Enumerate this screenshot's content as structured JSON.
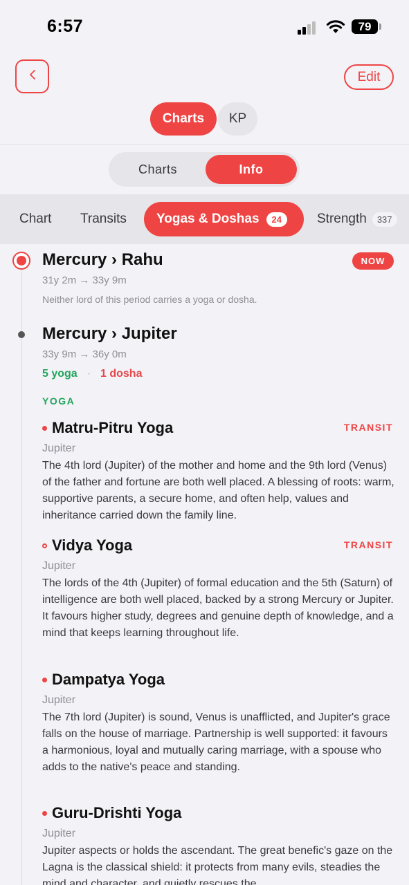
{
  "status": {
    "time": "6:57",
    "battery": "79"
  },
  "header": {
    "back_icon": "chevron-left-icon",
    "edit_label": "Edit"
  },
  "top_segment": {
    "charts": "Charts",
    "kp": "KP"
  },
  "mid_segment": {
    "charts": "Charts",
    "info": "Info"
  },
  "tabs": {
    "chart": "Chart",
    "transits": "Transits",
    "yogas": "Yogas & Doshas",
    "yogas_badge": "24",
    "strength": "Strength",
    "strength_badge": "337"
  },
  "periods": [
    {
      "title": "Mercury › Rahu",
      "range": "31y 2m → 33y 9m",
      "note": "Neither lord of this period carries a yoga or dosha.",
      "badge": "NOW"
    },
    {
      "title": "Mercury › Jupiter",
      "range": "33y 9m → 36y 0m",
      "yoga_count": "5 yoga",
      "sep": "·",
      "dosha_count": "1 dosha",
      "section": "YOGA"
    }
  ],
  "yogas": [
    {
      "name": "Matru-Pitru Yoga",
      "tag": "TRANSIT",
      "planet": "Jupiter",
      "desc": "The 4th lord (Jupiter) of the mother and home and the 9th lord (Venus) of the father and fortune are both well placed. A blessing of roots: warm, supportive parents, a secure home, and often help, values and inheritance carried down the family line."
    },
    {
      "name": "Vidya Yoga",
      "tag": "TRANSIT",
      "planet": "Jupiter",
      "desc": "The lords of the 4th (Jupiter) of formal education and the 5th (Saturn) of intelligence are both well placed, backed by a strong Mercury or Jupiter. It favours higher study, degrees and genuine depth of knowledge, and a mind that keeps learning throughout life."
    },
    {
      "name": "Dampatya Yoga",
      "planet": "Jupiter",
      "desc": "The 7th lord (Jupiter) is sound, Venus is unafflicted, and Jupiter's grace falls on the house of marriage. Partnership is well supported: it favours a harmonious, loyal and mutually caring marriage, with a spouse who adds to the native's peace and standing."
    },
    {
      "name": "Guru-Drishti Yoga",
      "planet": "Jupiter",
      "desc": "Jupiter aspects or holds the ascendant. The great benefic's gaze on the Lagna is the classical shield: it protects from many evils, steadies the mind and character, and quietly rescues the"
    }
  ],
  "colors": {
    "accent": "#ef4444",
    "yoga": "#22a55b",
    "dosha": "#e5484d"
  }
}
